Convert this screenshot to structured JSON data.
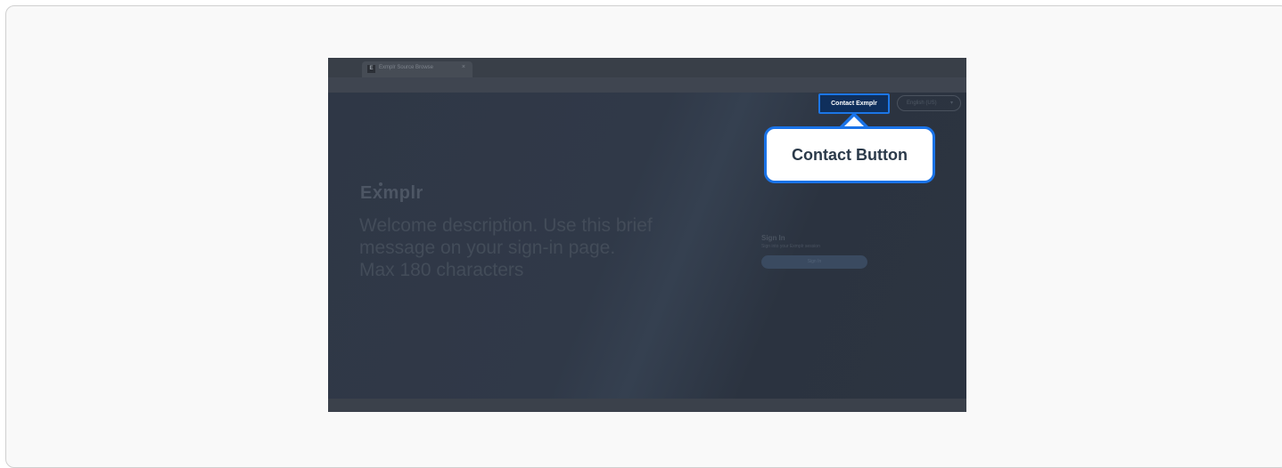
{
  "browser": {
    "tab_title": "Exmplr Source Browse",
    "tab_favicon": "E",
    "tab_close": "×"
  },
  "header": {
    "contact_label": "Contact Exmplr",
    "language_label": "English (US)",
    "language_chevron": "▾"
  },
  "hero": {
    "brand": "Exmplr",
    "welcome": "Welcome description. Use this brief message on your sign-in page. Max 180 characters"
  },
  "signin": {
    "title": "Sign In",
    "subtitle": "Sign into your Exmplr session",
    "button_label": "Sign In"
  },
  "callout": {
    "label": "Contact Button"
  },
  "colors": {
    "accent": "#1a73e8",
    "contact_bg": "#0f2f5c",
    "page_bg": "#2e3644"
  }
}
